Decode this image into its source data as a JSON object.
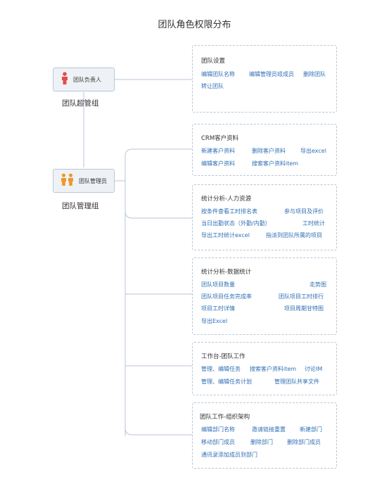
{
  "title": "团队角色权限分布",
  "roles": [
    {
      "label": "团队负责人",
      "group": "团队超管组"
    },
    {
      "label": "团队管理员",
      "group": "团队管理组"
    }
  ],
  "cards": [
    {
      "title": "团队设置",
      "items": [
        "编辑团队名称",
        "编辑管理员组成员",
        "删除团队",
        "转让团队"
      ]
    },
    {
      "title": "CRM客户资料",
      "items": [
        "新建客户资料",
        "删除客户资料",
        "导出excel",
        "编辑客户资料",
        "搜索客户资料item"
      ]
    },
    {
      "title": "统计分析-人力资源",
      "items": [
        "按条件查看工时排名表",
        "参与项目及评价",
        "当日出勤状态（外勤/内勤）",
        "工时统计",
        "导出工时统计excel",
        "指派到团队所属的项目"
      ]
    },
    {
      "title": "统计分析-数据统计",
      "items": [
        "团队项目数量",
        "走势图",
        "团队项目任务完成率",
        "团队项目工时排行",
        "项目工时详情",
        "项目周期甘特图",
        "导出Excel"
      ]
    },
    {
      "title": "工作台-团队工作",
      "items": [
        "管理、编辑任务",
        "搜索客户资料item",
        "讨论IM",
        "管理、编辑任务计划",
        "管理团队共享文件"
      ]
    },
    {
      "title": "团队工作-组织架构",
      "items": [
        "编辑部门名称",
        "邀请链接重置",
        "新建部门",
        "移动部门成员",
        "删除部门",
        "删除部门成员",
        "通讯录添加成员到部门"
      ]
    }
  ],
  "colors": {
    "connector": "#b9c6d4",
    "card_border": "#b7c7d8",
    "item_text": "#2f6fb5",
    "icon_red": "#e64b4b",
    "icon_orange": "#f0972a"
  }
}
